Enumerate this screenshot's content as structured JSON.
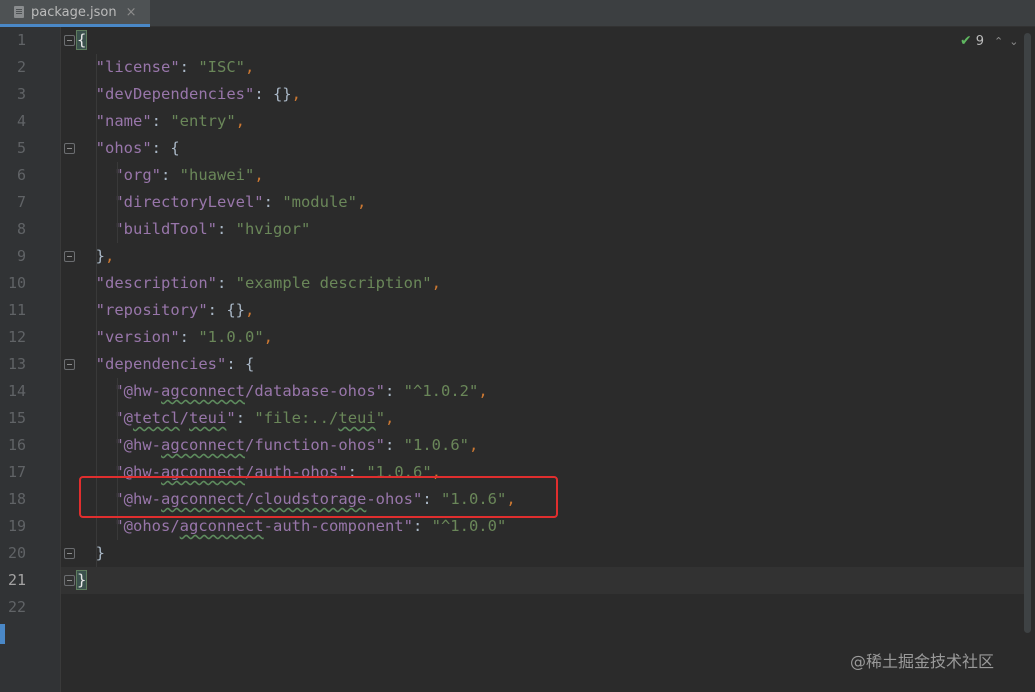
{
  "tab": {
    "label": "package.json",
    "close": "×"
  },
  "inspection": {
    "count": "9"
  },
  "lines": [
    {
      "n": "1",
      "segs": [
        [
          "brace-hl",
          "{"
        ]
      ]
    },
    {
      "n": "2",
      "segs": [
        [
          "txt",
          "  "
        ],
        [
          "k",
          "\"license\""
        ],
        [
          "txt",
          ": "
        ],
        [
          "s",
          "\"ISC\""
        ],
        [
          "p",
          ","
        ]
      ]
    },
    {
      "n": "3",
      "segs": [
        [
          "txt",
          "  "
        ],
        [
          "k",
          "\"devDependencies\""
        ],
        [
          "txt",
          ": {}"
        ],
        [
          "p",
          ","
        ]
      ]
    },
    {
      "n": "4",
      "segs": [
        [
          "txt",
          "  "
        ],
        [
          "k",
          "\"name\""
        ],
        [
          "txt",
          ": "
        ],
        [
          "s",
          "\"entry\""
        ],
        [
          "p",
          ","
        ]
      ]
    },
    {
      "n": "5",
      "segs": [
        [
          "txt",
          "  "
        ],
        [
          "k",
          "\"ohos\""
        ],
        [
          "txt",
          ": {"
        ]
      ]
    },
    {
      "n": "6",
      "segs": [
        [
          "txt",
          "    "
        ],
        [
          "k",
          "\"org\""
        ],
        [
          "txt",
          ": "
        ],
        [
          "s",
          "\"huawei\""
        ],
        [
          "p",
          ","
        ]
      ]
    },
    {
      "n": "7",
      "segs": [
        [
          "txt",
          "    "
        ],
        [
          "k",
          "\"directoryLevel\""
        ],
        [
          "txt",
          ": "
        ],
        [
          "s",
          "\"module\""
        ],
        [
          "p",
          ","
        ]
      ]
    },
    {
      "n": "8",
      "segs": [
        [
          "txt",
          "    "
        ],
        [
          "k",
          "\"buildTool\""
        ],
        [
          "txt",
          ": "
        ],
        [
          "s",
          "\"hvigor\""
        ]
      ]
    },
    {
      "n": "9",
      "segs": [
        [
          "txt",
          "  }"
        ],
        [
          "p",
          ","
        ]
      ]
    },
    {
      "n": "10",
      "segs": [
        [
          "txt",
          "  "
        ],
        [
          "k",
          "\"description\""
        ],
        [
          "txt",
          ": "
        ],
        [
          "s",
          "\"example description\""
        ],
        [
          "p",
          ","
        ]
      ]
    },
    {
      "n": "11",
      "segs": [
        [
          "txt",
          "  "
        ],
        [
          "k",
          "\"repository\""
        ],
        [
          "txt",
          ": {}"
        ],
        [
          "p",
          ","
        ]
      ]
    },
    {
      "n": "12",
      "segs": [
        [
          "txt",
          "  "
        ],
        [
          "k",
          "\"version\""
        ],
        [
          "txt",
          ": "
        ],
        [
          "s",
          "\"1.0.0\""
        ],
        [
          "p",
          ","
        ]
      ]
    },
    {
      "n": "13",
      "segs": [
        [
          "txt",
          "  "
        ],
        [
          "k",
          "\"dependencies\""
        ],
        [
          "txt",
          ": {"
        ]
      ]
    },
    {
      "n": "14",
      "segs": [
        [
          "txt",
          "    "
        ],
        [
          "k",
          "\"@hw-"
        ],
        [
          "k typo",
          "agconnect"
        ],
        [
          "k",
          "/database-ohos\""
        ],
        [
          "txt",
          ": "
        ],
        [
          "s",
          "\"^1.0.2\""
        ],
        [
          "p",
          ","
        ]
      ]
    },
    {
      "n": "15",
      "segs": [
        [
          "txt",
          "    "
        ],
        [
          "k",
          "\"@"
        ],
        [
          "k typo",
          "tetcl"
        ],
        [
          "k",
          "/"
        ],
        [
          "k typo",
          "teui"
        ],
        [
          "k",
          "\""
        ],
        [
          "txt",
          ": "
        ],
        [
          "s",
          "\"file:../"
        ],
        [
          "s typo",
          "teui"
        ],
        [
          "s",
          "\""
        ],
        [
          "p",
          ","
        ]
      ]
    },
    {
      "n": "16",
      "segs": [
        [
          "txt",
          "    "
        ],
        [
          "k",
          "\"@hw-"
        ],
        [
          "k typo",
          "agconnect"
        ],
        [
          "k",
          "/function-ohos\""
        ],
        [
          "txt",
          ": "
        ],
        [
          "s",
          "\"1.0.6\""
        ],
        [
          "p",
          ","
        ]
      ]
    },
    {
      "n": "17",
      "segs": [
        [
          "txt",
          "    "
        ],
        [
          "k",
          "\"@hw-"
        ],
        [
          "k typo",
          "agconnect"
        ],
        [
          "k",
          "/auth-ohos\""
        ],
        [
          "txt",
          ": "
        ],
        [
          "s",
          "\"1.0.6\""
        ],
        [
          "p",
          ","
        ]
      ]
    },
    {
      "n": "18",
      "segs": [
        [
          "txt",
          "    "
        ],
        [
          "k",
          "\"@hw-"
        ],
        [
          "k typo",
          "agconnect"
        ],
        [
          "k",
          "/"
        ],
        [
          "k typo",
          "cloudstorage"
        ],
        [
          "k",
          "-ohos\""
        ],
        [
          "txt",
          ": "
        ],
        [
          "s",
          "\"1.0.6\""
        ],
        [
          "p",
          ","
        ]
      ]
    },
    {
      "n": "19",
      "segs": [
        [
          "txt",
          "    "
        ],
        [
          "k",
          "\"@ohos/"
        ],
        [
          "k typo",
          "agconnect"
        ],
        [
          "k",
          "-auth-component\""
        ],
        [
          "txt",
          ": "
        ],
        [
          "s",
          "\"^1.0.0\""
        ]
      ]
    },
    {
      "n": "20",
      "segs": [
        [
          "txt",
          "  }"
        ]
      ]
    },
    {
      "n": "21",
      "segs": [
        [
          "brace-hl",
          "}"
        ]
      ]
    },
    {
      "n": "22",
      "segs": []
    }
  ],
  "watermark": "@稀土掘金技术社区"
}
